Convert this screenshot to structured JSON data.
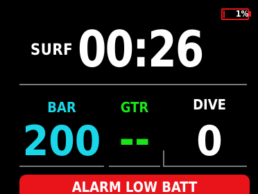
{
  "battery": {
    "percent_label": "1%",
    "level": 0.01
  },
  "surf": {
    "label": "SURF",
    "time": "00:26"
  },
  "columns": [
    {
      "label": "BAR",
      "value": "200",
      "color": "#19d6e8"
    },
    {
      "label": "GTR",
      "value": "--",
      "color": "#19e619"
    },
    {
      "label": "DIVE",
      "value": "0",
      "color": "#ffffff"
    }
  ],
  "alarm": {
    "text": "ALARM LOW BATT",
    "color": "#e8141a"
  }
}
